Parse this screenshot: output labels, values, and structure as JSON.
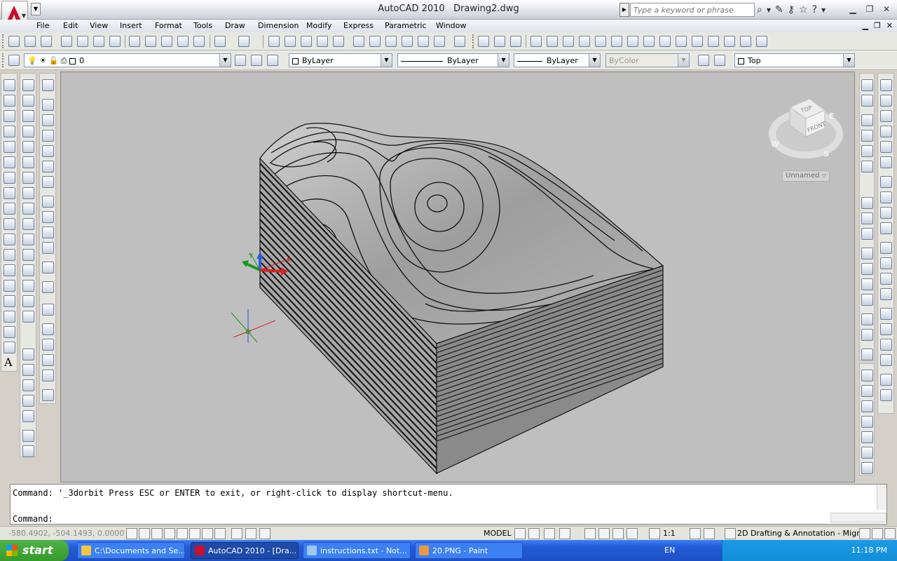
{
  "app": {
    "title": "AutoCAD 2010",
    "document": "Drawing2.dwg"
  },
  "search": {
    "placeholder": "Type a keyword or phrase"
  },
  "menu": {
    "items": [
      "File",
      "Edit",
      "View",
      "Insert",
      "Format",
      "Tools",
      "Draw",
      "Dimension",
      "Modify",
      "Express",
      "Parametric",
      "Window"
    ]
  },
  "layers": {
    "current_layer": "0",
    "color": "ByLayer",
    "linetype": "ByLayer",
    "lineweight": "ByLayer",
    "plot_style": "ByColor",
    "view": "Top"
  },
  "viewcube": {
    "faces": {
      "top": "TOP",
      "front": "FRONT"
    },
    "compass": {
      "w": "W",
      "s": "S",
      "e": "E"
    },
    "ucs_label": "Unnamed"
  },
  "ucs_icon": {
    "y": "Y",
    "x": "X"
  },
  "command": {
    "history": "Command: '_3dorbit Press ESC or ENTER to exit, or right-click to display shortcut-menu.",
    "prompt": "Command:"
  },
  "status": {
    "coordinates": "-580.4902, -504.1493, 0.0000",
    "space": "MODEL",
    "scale": "1:1",
    "workspace": "2D Drafting & Annotation - Migra"
  },
  "taskbar": {
    "start": "start",
    "tasks": [
      {
        "label": "C:\\Documents and Se...",
        "color": "#f5c542"
      },
      {
        "label": "AutoCAD 2010 - [Dra...",
        "color": "#c8102e"
      },
      {
        "label": "instructions.txt - Not...",
        "color": "#9ec8f0"
      },
      {
        "label": "20.PNG - Paint",
        "color": "#e89a3c"
      }
    ],
    "language": "EN",
    "clock": "11:18 PM"
  }
}
